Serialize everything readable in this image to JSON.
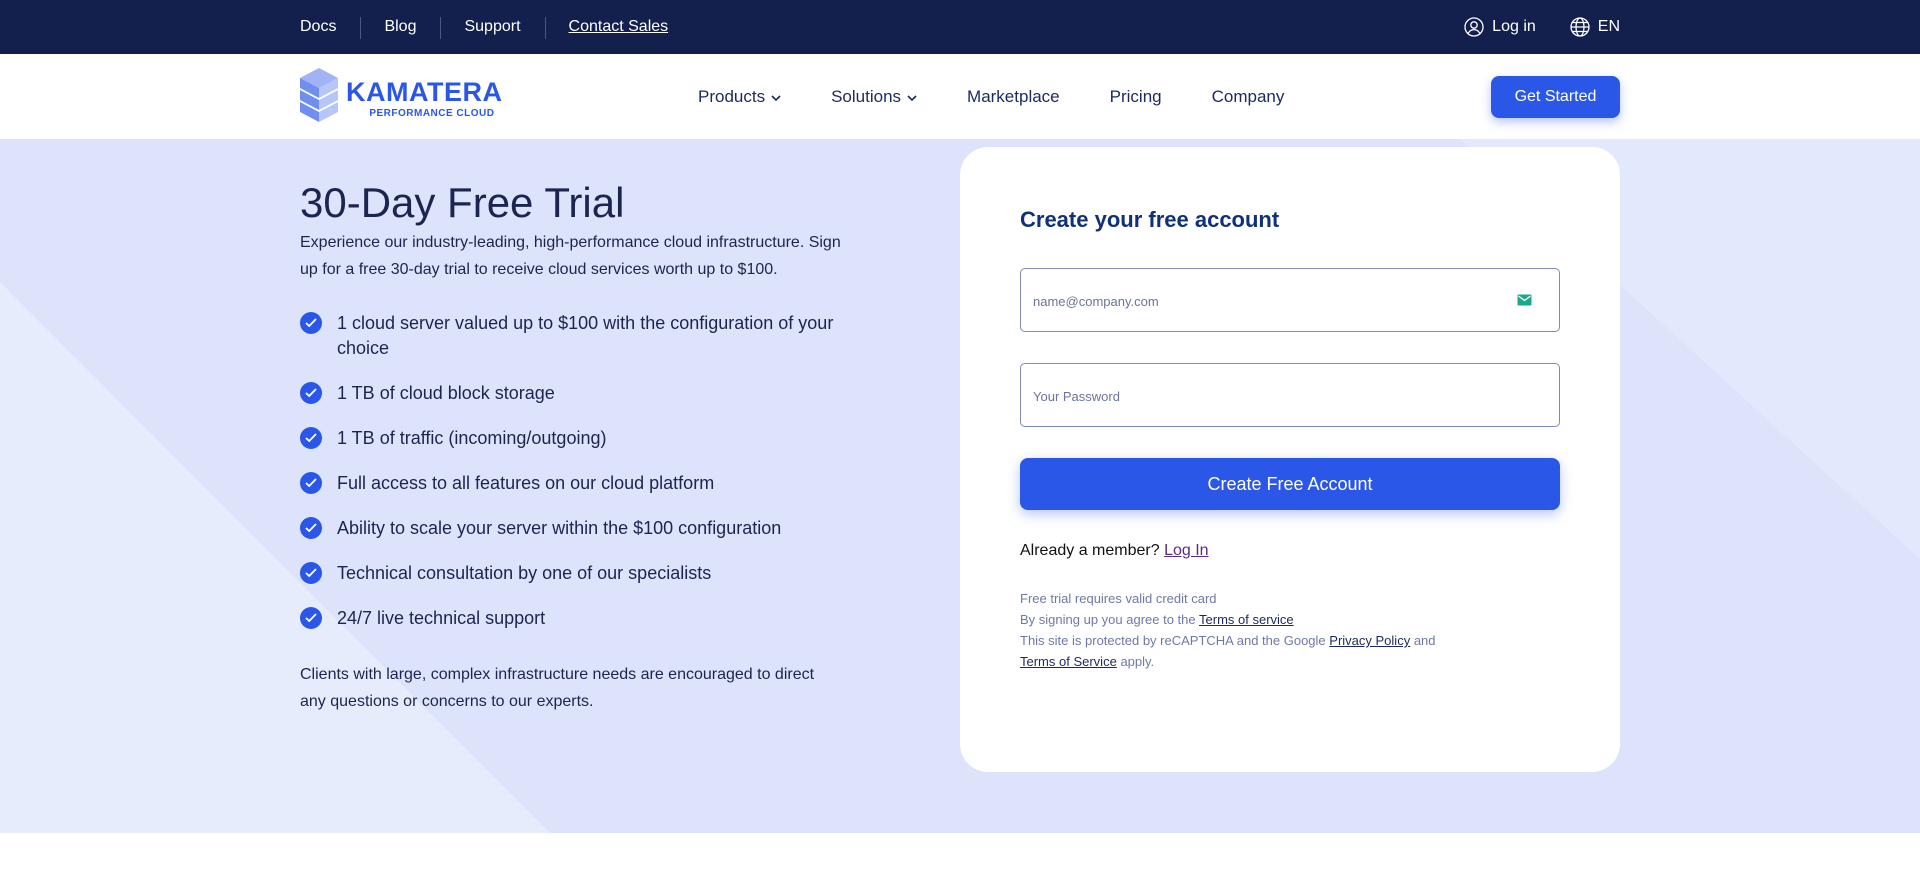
{
  "topbar": {
    "links": [
      "Docs",
      "Blog",
      "Support",
      "Contact Sales"
    ],
    "login": "Log in",
    "language": "EN",
    "icons": [
      "user-circle-icon",
      "globe-icon"
    ]
  },
  "nav": {
    "brand": "KAMATERA",
    "tagline": "PERFORMANCE CLOUD",
    "menu": [
      "Products",
      "Solutions",
      "Marketplace",
      "Pricing",
      "Company"
    ],
    "cta": "Get Started"
  },
  "hero": {
    "title": "30-Day Free Trial",
    "lead": "Experience our industry-leading, high-performance cloud infrastructure. Sign up for a free 30-day trial to receive cloud services worth up to $100.",
    "features": [
      "1 cloud server valued up to $100 with the configuration of your choice",
      "1 TB of cloud block storage",
      "1 TB of traffic (incoming/outgoing)",
      "Full access to all features on our cloud platform",
      "Ability to scale your server within the $100 configuration",
      "Technical consultation by one of our specialists",
      "24/7 live technical support"
    ],
    "note": "Clients with large, complex infrastructure needs are encouraged to direct any questions or concerns to our experts."
  },
  "form": {
    "title": "Create your free account",
    "email_placeholder": "name@company.com",
    "password_placeholder": "Your Password",
    "submit": "Create Free Account",
    "member_text": "Already a member?",
    "member_link": "Log In",
    "legal": {
      "line1": "Free trial requires valid credit card",
      "line2_prefix": "By signing up you agree to the",
      "line2_link": "Terms of service",
      "line3_prefix": "This site is protected by reCAPTCHA and the Google",
      "line3_link": "Privacy Policy",
      "line3_suffix": "and",
      "line4_link": "Terms of Service",
      "line4_suffix": "apply."
    }
  },
  "colors": {
    "topbar_bg": "#13204d",
    "accent": "#2b57e8",
    "hero_bg": "#dce3fa",
    "heading": "#10307a"
  }
}
